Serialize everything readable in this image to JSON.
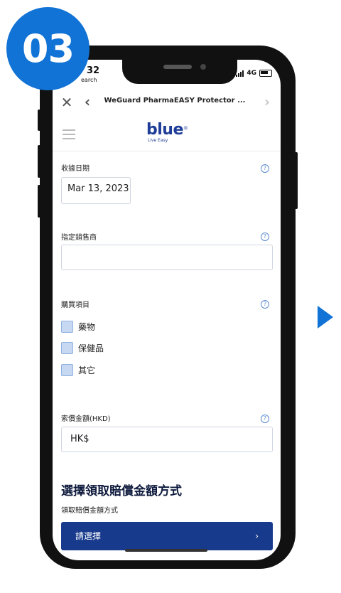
{
  "step_badge": "03",
  "status": {
    "time": "32",
    "sub": "earch",
    "network": "4G"
  },
  "browser": {
    "title": "WeGuard PharmaEASY Protector ...",
    "close_icon": "close-icon",
    "back_icon": "chevron-left-icon",
    "forward_icon": "chevron-right-icon"
  },
  "app": {
    "logo": "blue",
    "tagline": "Live Easy"
  },
  "form": {
    "receipt_date_label": "收據日期",
    "receipt_date_value": "Mar 13, 2023",
    "dealer_label": "指定銷售商",
    "dealer_value": "",
    "purchase_label": "購買項目",
    "purchase_items": [
      "藥物",
      "保健品",
      "其它"
    ],
    "amount_label": "索償金額(HKD)",
    "amount_value": "HK$",
    "help_glyph": "?"
  },
  "payout": {
    "title": "選擇領取賠償金額方式",
    "subtitle": "領取賠償金額方式",
    "select_label": "請選擇",
    "select_chevron": "›"
  },
  "colors": {
    "badge": "#1273d6",
    "brand": "#1f3d98",
    "button": "#173a8c",
    "arrow": "#1273d6"
  }
}
